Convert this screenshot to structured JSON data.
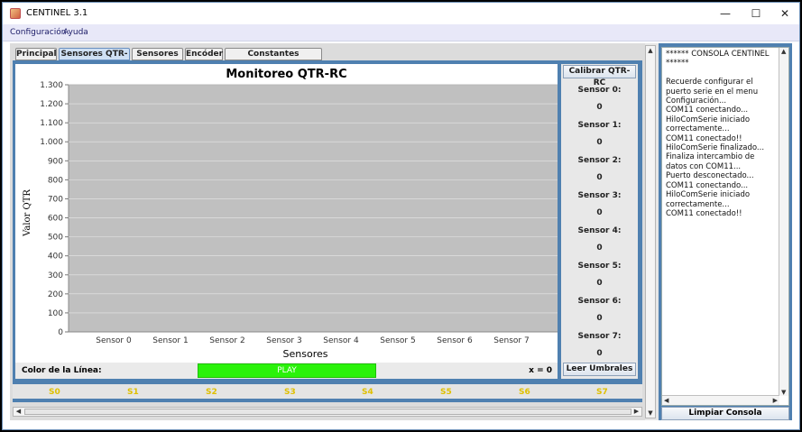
{
  "window": {
    "title": "CENTINEL 3.1",
    "minimize_glyph": "—",
    "maximize_glyph": "☐",
    "close_glyph": "✕"
  },
  "menu": {
    "items": [
      "Configuración",
      "Ayuda"
    ]
  },
  "tabs": [
    {
      "label": "Principal",
      "active": false
    },
    {
      "label": "Sensores QTR-RC",
      "active": true
    },
    {
      "label": "Sensores IR",
      "active": false
    },
    {
      "label": "Encóder",
      "active": false
    },
    {
      "label": "Constantes controladores",
      "active": false
    }
  ],
  "chart_data": {
    "type": "bar",
    "title": "Monitoreo QTR-RC",
    "xlabel": "Sensores",
    "ylabel": "Valor QTR",
    "categories": [
      "Sensor 0",
      "Sensor 1",
      "Sensor 2",
      "Sensor 3",
      "Sensor 4",
      "Sensor 5",
      "Sensor 6",
      "Sensor 7"
    ],
    "values": [
      0,
      0,
      0,
      0,
      0,
      0,
      0,
      0
    ],
    "ylim": [
      0,
      1300
    ],
    "yticks": [
      0,
      100,
      200,
      300,
      400,
      500,
      600,
      700,
      800,
      900,
      1000,
      1100,
      1200,
      1300
    ],
    "ytick_labels": [
      "0",
      "100",
      "200",
      "300",
      "400",
      "500",
      "600",
      "700",
      "800",
      "900",
      "1.000",
      "1.100",
      "1.200",
      "1.300"
    ],
    "plot_background": "#c0c0c0",
    "grid": true,
    "grid_color": "#e8e8e8"
  },
  "sensors": {
    "calibrate_label": "Calibrar QTR-RC",
    "thresholds_label": "Leer Umbrales",
    "items": [
      {
        "label": "Sensor 0:",
        "value": "0"
      },
      {
        "label": "Sensor 1:",
        "value": "0"
      },
      {
        "label": "Sensor 2:",
        "value": "0"
      },
      {
        "label": "Sensor 3:",
        "value": "0"
      },
      {
        "label": "Sensor 4:",
        "value": "0"
      },
      {
        "label": "Sensor 5:",
        "value": "0"
      },
      {
        "label": "Sensor 6:",
        "value": "0"
      },
      {
        "label": "Sensor 7:",
        "value": "0"
      }
    ]
  },
  "controls": {
    "line_color_label": "Color de la Línea:",
    "play_label": "PLAY",
    "x_readout": "x = 0"
  },
  "legend": {
    "items": [
      "S0",
      "S1",
      "S2",
      "S3",
      "S4",
      "S5",
      "S6",
      "S7"
    ],
    "color": "#e0c000"
  },
  "console": {
    "text": "****** CONSOLA CENTINEL ******\n\nRecuerde configurar el puerto serie en el menu Configuración...\nCOM11 conectando...\nHiloComSerie iniciado correctamente...\nCOM11 conectado!!\nHiloComSerie finalizado...\nFinaliza intercambio de datos con COM11...\nPuerto desconectado...\nCOM11 conectando...\nHiloComSerie iniciado correctamente...\nCOM11 conectado!!",
    "clear_label": "Limpiar Consola"
  },
  "colors": {
    "accent_blue": "#4f80b0",
    "play_green": "#2af20a"
  }
}
